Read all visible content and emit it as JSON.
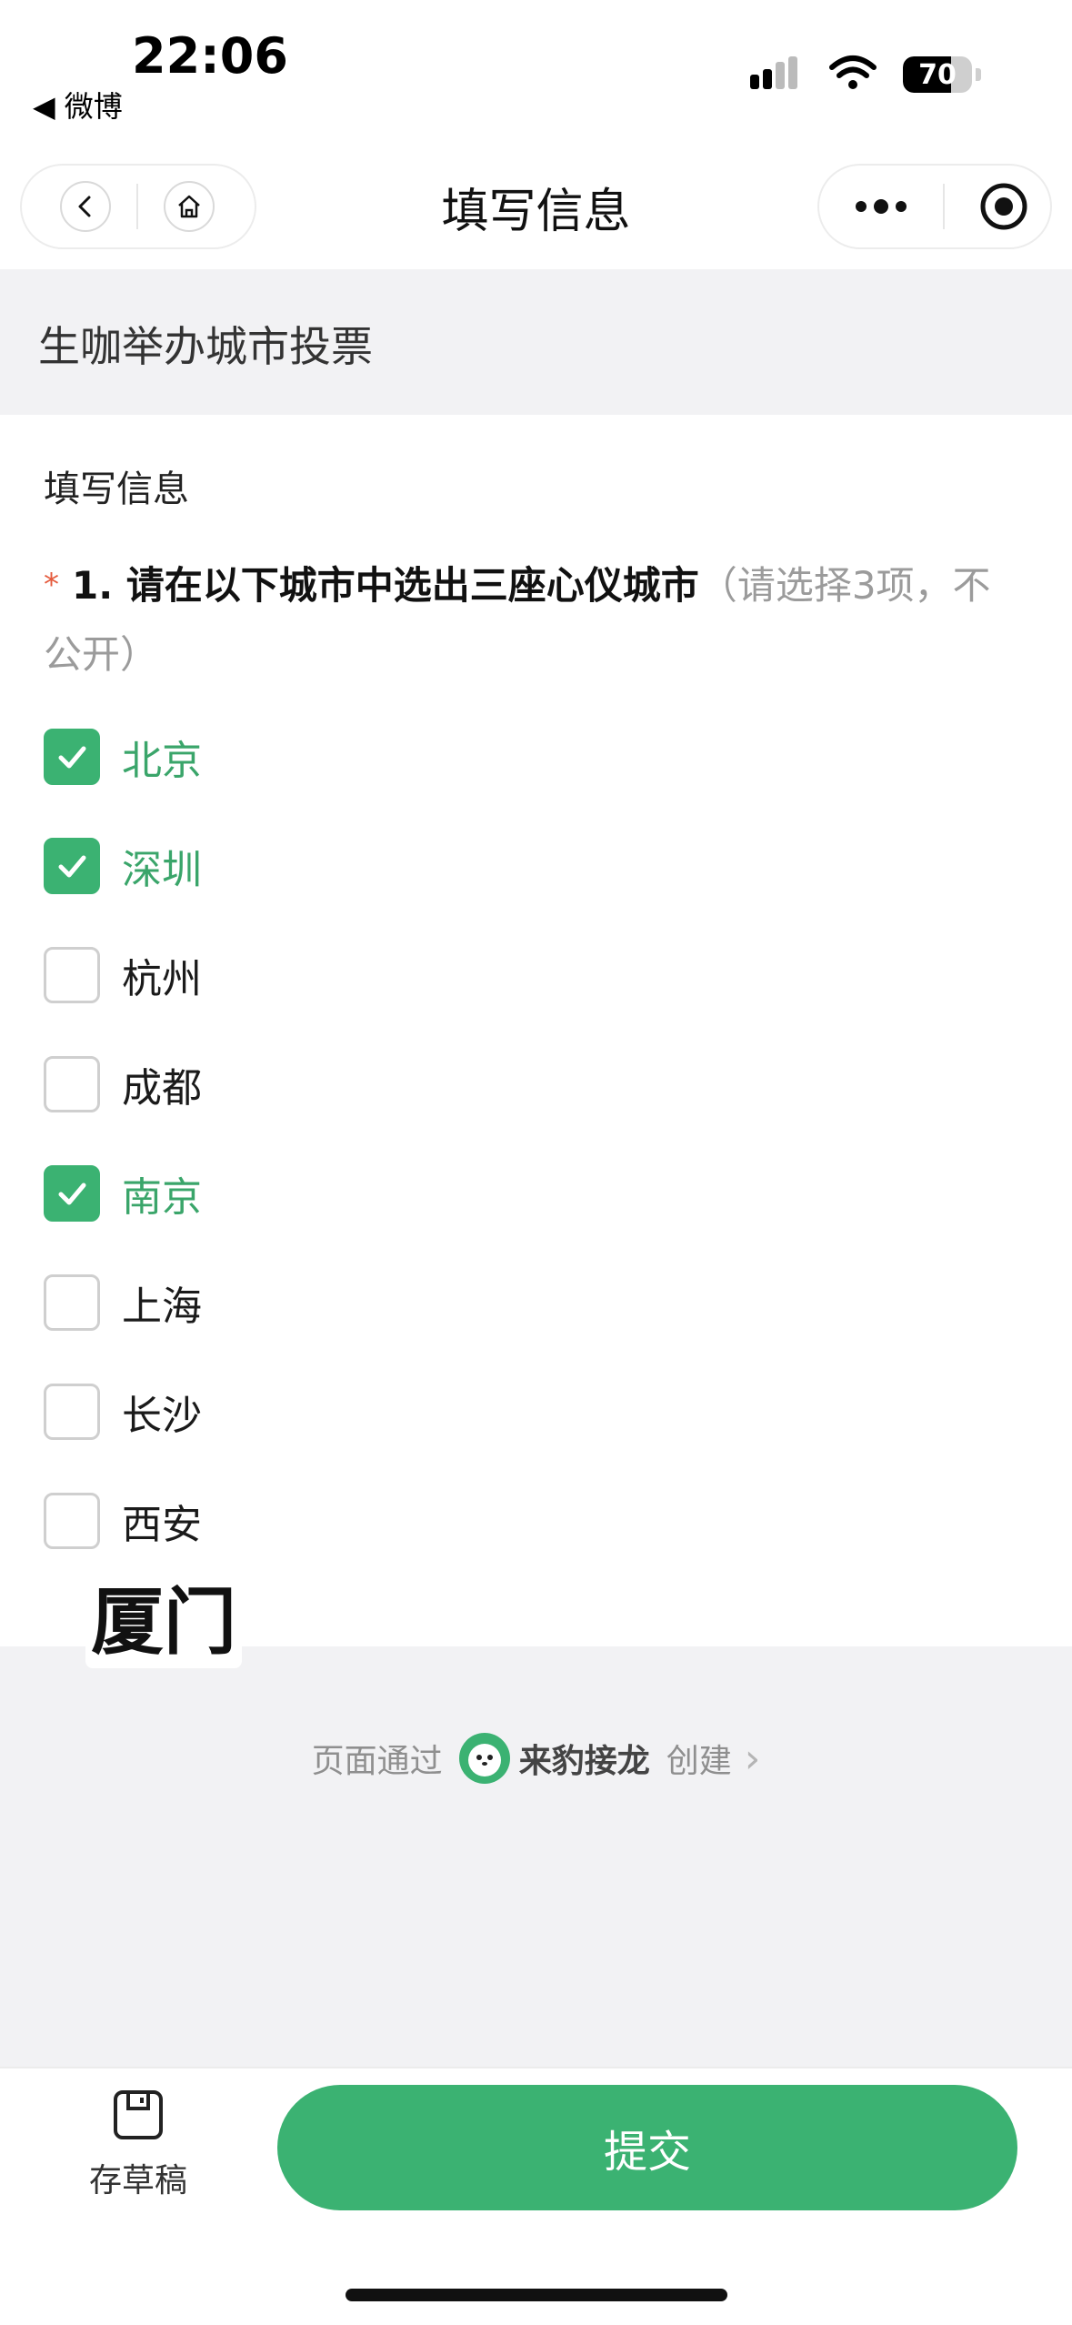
{
  "status_bar": {
    "time": "22:06",
    "back_app": "◀ 微博",
    "battery_percent": 70,
    "battery_label": "70"
  },
  "nav": {
    "title": "填写信息"
  },
  "form": {
    "title": "生咖举办城市投票",
    "section_label": "填写信息",
    "question": {
      "required_mark": "*",
      "text": "1. 请在以下城市中选出三座心仪城市",
      "hint": "（请选择3项，不公开）"
    },
    "options": [
      {
        "label": "北京",
        "checked": true
      },
      {
        "label": "深圳",
        "checked": true
      },
      {
        "label": "杭州",
        "checked": false
      },
      {
        "label": "成都",
        "checked": false
      },
      {
        "label": "南京",
        "checked": true
      },
      {
        "label": "上海",
        "checked": false
      },
      {
        "label": "长沙",
        "checked": false
      },
      {
        "label": "西安",
        "checked": false
      }
    ],
    "overlay_label": "厦门"
  },
  "footer": {
    "powered_prefix": "页面通过",
    "brand": "来豹接龙",
    "powered_suffix": "创建",
    "chevron": "›"
  },
  "bottom_bar": {
    "draft_label": "存草稿",
    "submit_label": "提交"
  },
  "colors": {
    "accent": "#3bb272",
    "required": "#e55a3c"
  }
}
